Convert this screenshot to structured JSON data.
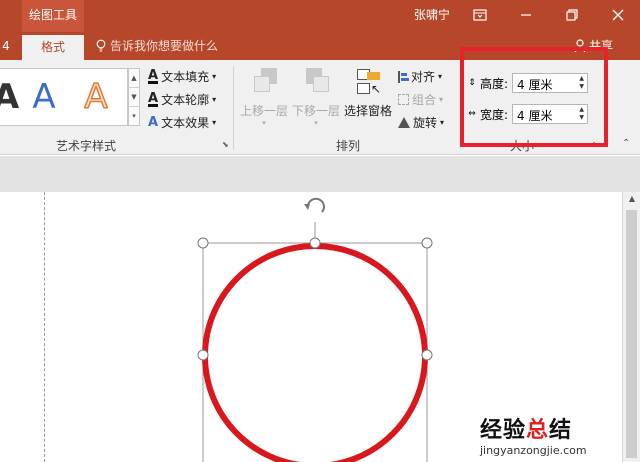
{
  "titlebar": {
    "context_tab": "绘图工具",
    "user": "张啸宁",
    "buttons": [
      "ribbon-display-icon",
      "minimize-icon",
      "restore-icon",
      "close-icon"
    ]
  },
  "tabs": {
    "partial_tab": "4",
    "active_tab": "格式",
    "tell_me": "告诉我你想要做什么",
    "share": "共享"
  },
  "wordart": {
    "letter": "A",
    "text_fill": "文本填充",
    "text_outline": "文本轮廓",
    "text_effect": "文本效果",
    "group_label": "艺术字样式"
  },
  "arrange": {
    "bring_forward": "上移一层",
    "send_backward": "下移一层",
    "selection_pane": "选择窗格",
    "align": "对齐",
    "group": "组合",
    "rotate": "旋转",
    "group_label": "排列"
  },
  "size": {
    "height_label": "高度:",
    "height_value": "4 厘米",
    "width_label": "宽度:",
    "width_value": "4 厘米",
    "group_label": "大小"
  },
  "watermark": {
    "main_prefix": "经验",
    "main_red": "总",
    "main_suffix": "结",
    "url": "jingyanzongjie.com"
  },
  "colors": {
    "accent": "#b7472a",
    "highlight": "#e8222b",
    "circle": "#d9181e"
  }
}
